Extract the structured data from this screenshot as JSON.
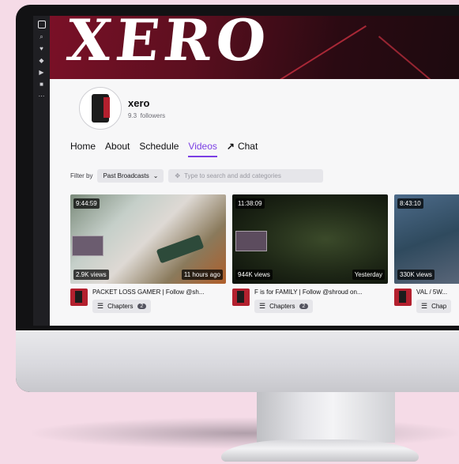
{
  "banner": {
    "title": "XERO"
  },
  "channel": {
    "name": "xero",
    "followers": "9.3  followers"
  },
  "tabs": [
    {
      "label": "Home",
      "active": false
    },
    {
      "label": "About",
      "active": false
    },
    {
      "label": "Schedule",
      "active": false
    },
    {
      "label": "Videos",
      "active": true
    },
    {
      "label": "Chat",
      "active": false
    }
  ],
  "filter": {
    "label": "Filter by",
    "selected": "Past Broadcasts",
    "search_placeholder": "Type to search and add categories"
  },
  "videos": [
    {
      "duration": "9:44:59",
      "views": "2.9K views",
      "age": "11 hours ago",
      "title": "PACKET LOSS GAMER | Follow @sh...",
      "chapters_label": "Chapters",
      "chapters_count": "2"
    },
    {
      "duration": "11:38:09",
      "views": "944K views",
      "age": "Yesterday",
      "title": "F is for FAMILY | Follow @shroud on...",
      "chapters_label": "Chapters",
      "chapters_count": "2"
    },
    {
      "duration": "8:43:10",
      "views": "330K views",
      "age": "",
      "title": "VAL / 5W...",
      "chapters_label": "Chap",
      "chapters_count": ""
    }
  ],
  "icons": {
    "chevron": "chevron-down-icon",
    "search": "categories-search-icon",
    "list": "list-icon",
    "chat_arrow": "arrow-up-right-icon"
  },
  "colors": {
    "accent": "#7b3fe4",
    "banner": "#5c0f1f"
  }
}
